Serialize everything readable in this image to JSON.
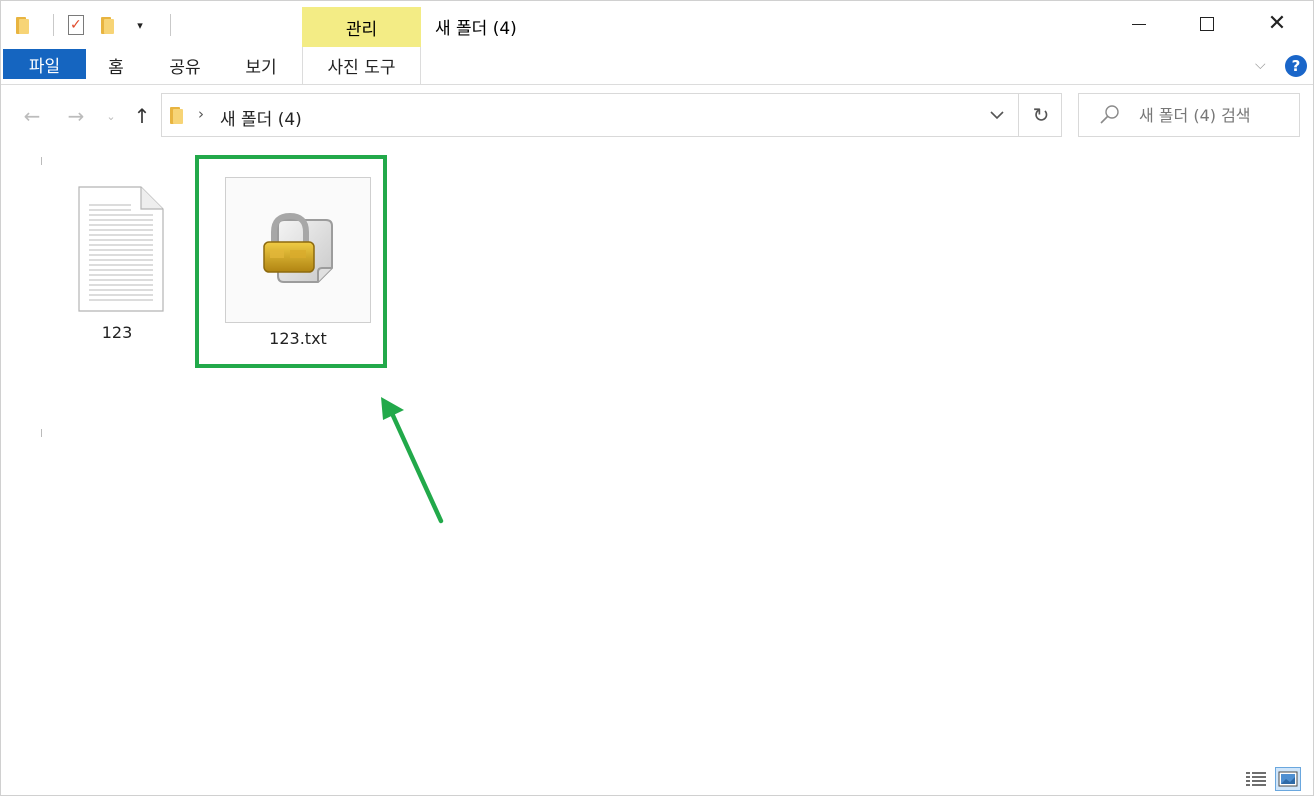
{
  "window": {
    "title": "새 폴더 (4)",
    "context_group": "관리"
  },
  "ribbon": {
    "tabs": [
      {
        "label": "파일"
      },
      {
        "label": "홈"
      },
      {
        "label": "공유"
      },
      {
        "label": "보기"
      },
      {
        "label": "사진 도구"
      }
    ],
    "help_label": "?"
  },
  "navigation": {
    "breadcrumb": [
      "새 폴더 (4)"
    ],
    "search_placeholder": "새 폴더 (4) 검색"
  },
  "files": [
    {
      "name": "123",
      "icon": "text-document-icon",
      "selected": false
    },
    {
      "name": "123.txt",
      "icon": "locked-file-icon",
      "selected": false,
      "highlighted": true
    }
  ],
  "annotation": {
    "highlight_color": "#22a94a",
    "arrow_color": "#22a94a"
  },
  "colors": {
    "file_tab": "#1565c0",
    "context_tab": "#f3ec85",
    "help": "#1a66c9"
  },
  "icons": [
    "folder-icon",
    "properties-icon",
    "back-arrow-icon",
    "forward-arrow-icon",
    "up-arrow-icon",
    "refresh-icon",
    "search-icon",
    "minimize-icon",
    "maximize-icon",
    "close-icon",
    "details-view-icon",
    "large-icons-view-icon"
  ]
}
